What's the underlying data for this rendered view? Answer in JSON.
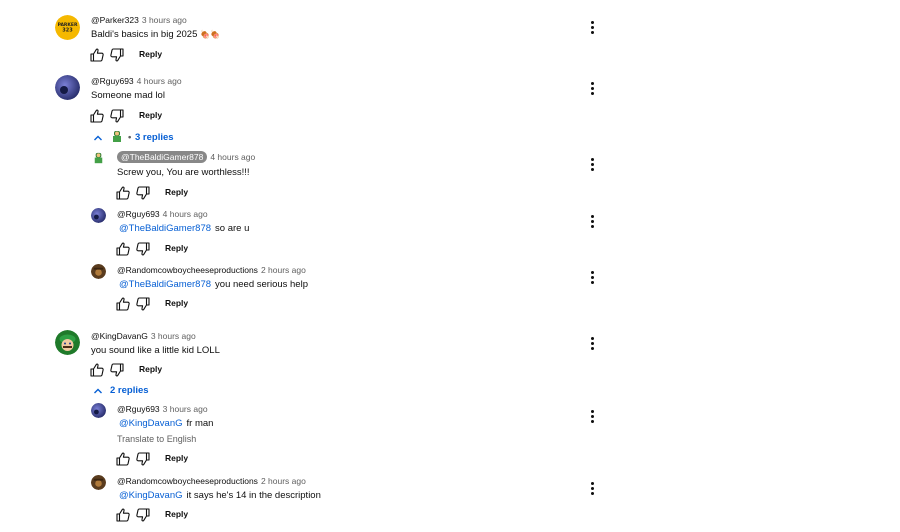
{
  "comments": [
    {
      "author": "@Parker323",
      "time": "3 hours ago",
      "text": "Baldi's basics in big 2025",
      "emoji": "🍖🍖",
      "reply_label": "Reply",
      "avatar": {
        "bg": "#f5b800",
        "label": "PARKER 323"
      }
    },
    {
      "author": "@Rguy693",
      "time": "4 hours ago",
      "text": "Someone mad lol",
      "reply_label": "Reply",
      "avatar": {
        "bg": "#3b4a9a"
      },
      "replies_toggle": "3 replies",
      "replies": [
        {
          "author": "@TheBaldiGamer878",
          "time": "4 hours ago",
          "text": "Screw you, You are worthless!!!",
          "reply_label": "Reply"
        },
        {
          "author": "@Rguy693",
          "time": "4 hours ago",
          "mention": "@TheBaldiGamer878",
          "text": "so are u",
          "reply_label": "Reply"
        },
        {
          "author": "@Randomcowboycheeseproductions",
          "time": "2 hours ago",
          "mention": "@TheBaldiGamer878",
          "text": "you need serious help",
          "reply_label": "Reply"
        }
      ]
    },
    {
      "author": "@KingDavanG",
      "time": "3 hours ago",
      "text": "you sound like a little kid LOLL",
      "reply_label": "Reply",
      "avatar": {
        "bg": "#1f7a2a"
      },
      "replies_toggle": "2 replies",
      "replies": [
        {
          "author": "@Rguy693",
          "time": "3 hours ago",
          "mention": "@KingDavanG",
          "text": "fr man",
          "translate": "Translate to English",
          "reply_label": "Reply"
        },
        {
          "author": "@Randomcowboycheeseproductions",
          "time": "2 hours ago",
          "mention": "@KingDavanG",
          "text": "it says he's 14 in the description",
          "reply_label": "Reply"
        }
      ]
    }
  ],
  "colors": {
    "link": "#065fd4",
    "text": "#0f0f0f",
    "muted": "#606060"
  }
}
